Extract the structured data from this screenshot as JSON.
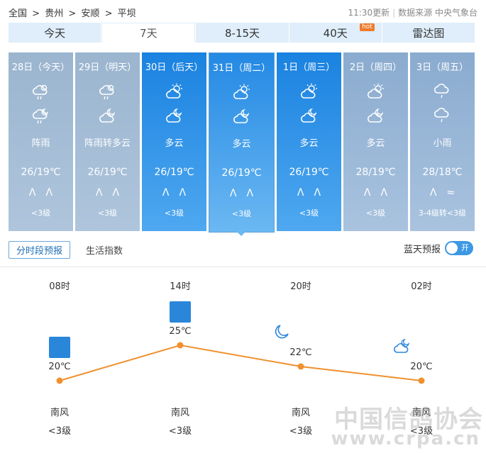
{
  "breadcrumb": [
    "全国",
    ">",
    "贵州",
    ">",
    "安顺",
    ">",
    "平坝"
  ],
  "meta": {
    "updated": "11:30更新",
    "source": "数据来源 中央气象台"
  },
  "tabs": [
    {
      "label": "今天"
    },
    {
      "label": "7天"
    },
    {
      "label": "8-15天"
    },
    {
      "label": "40天",
      "badge": "hot"
    },
    {
      "label": "雷达图"
    }
  ],
  "days": [
    {
      "date": "28日（今天）",
      "desc": "阵雨",
      "temp": "26/19℃",
      "wind_level": "<3级",
      "icon_day": "shower-icon",
      "icon_night": "shower-night-icon"
    },
    {
      "date": "29日（明天）",
      "desc": "阵雨转多云",
      "temp": "26/19℃",
      "wind_level": "<3级",
      "icon_day": "shower-icon",
      "icon_night": "cloudy-night-icon"
    },
    {
      "date": "30日（后天）",
      "desc": "多云",
      "temp": "26/19℃",
      "wind_level": "<3级",
      "icon_day": "partly-cloudy-icon",
      "icon_night": "cloudy-night-icon"
    },
    {
      "date": "31日（周二）",
      "desc": "多云",
      "temp": "26/19℃",
      "wind_level": "<3级",
      "icon_day": "partly-cloudy-icon",
      "icon_night": "cloudy-night-icon"
    },
    {
      "date": "1日（周三）",
      "desc": "多云",
      "temp": "26/19℃",
      "wind_level": "<3级",
      "icon_day": "partly-cloudy-icon",
      "icon_night": "cloudy-night-icon"
    },
    {
      "date": "2日（周四）",
      "desc": "多云",
      "temp": "28/19℃",
      "wind_level": "<3级",
      "icon_day": "partly-cloudy-icon",
      "icon_night": "cloudy-night-icon"
    },
    {
      "date": "3日（周五）",
      "desc": "小雨",
      "temp": "28/18℃",
      "wind_level": "3-4级转<3级",
      "icon_day": "light-rain-icon",
      "icon_night": "light-rain-icon"
    }
  ],
  "subtabs": {
    "active": "分时段预报",
    "other": "生活指数"
  },
  "bluesky": {
    "label": "蓝天预报",
    "toggle": "开"
  },
  "hourly": [
    {
      "time": "08时",
      "temp": "20℃",
      "temp_value": 20,
      "wind_dir": "南风",
      "wind_level": "<3级",
      "icon": "partly-cloudy-icon"
    },
    {
      "time": "14时",
      "temp": "25℃",
      "temp_value": 25,
      "wind_dir": "南风",
      "wind_level": "<3级",
      "icon": "partly-cloudy-icon"
    },
    {
      "time": "20时",
      "temp": "22℃",
      "temp_value": 22,
      "wind_dir": "南风",
      "wind_level": "<3级",
      "icon": "moon-icon"
    },
    {
      "time": "02时",
      "temp": "20℃",
      "temp_value": 20,
      "wind_dir": "南风",
      "wind_level": "<3级",
      "icon": "cloudy-night-icon"
    }
  ],
  "watermark": {
    "line1": "中国信鸽协会",
    "line2": "www.crpa.cn"
  },
  "colors": {
    "line": "#f0902e",
    "today": "#1a82e0",
    "past": "#9bb5cf"
  }
}
